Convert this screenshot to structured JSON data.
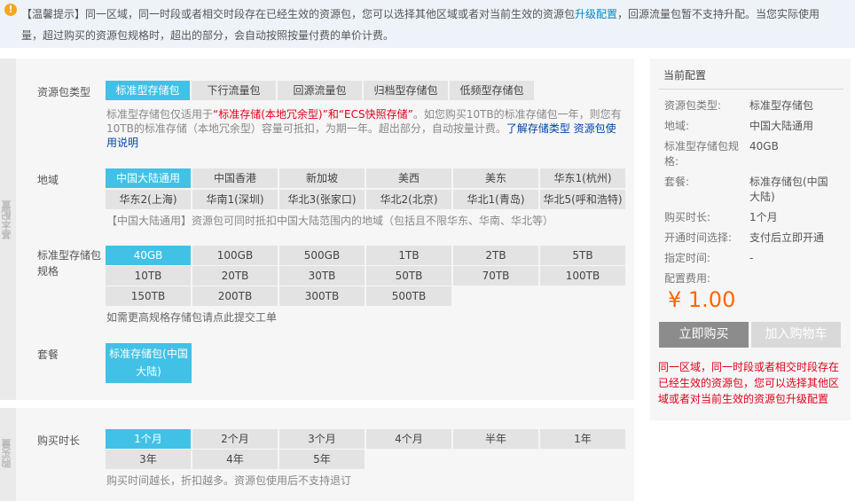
{
  "notice": {
    "icon": "info-icon",
    "line1_prefix": "【温馨提示】同一区域，同一时段或者相交时段存在已经生效的资源包，您可以选择其他区域或者对当前生效的资源包",
    "line1_link": "升级配置",
    "line1_suffix": "，回源流量包暂不支持升配。当您实际使用",
    "line2": "量，超过购买的资源包规格时，超出的部分，会自动按照按量付费的单价计费。"
  },
  "basic": {
    "side_label": "基本配置",
    "type_label": "资源包类型",
    "types": [
      "标准型存储包",
      "下行流量包",
      "回源流量包",
      "归档型存储包",
      "低频型存储包"
    ],
    "type_desc_prefix": "标准型存储包仅适用于",
    "type_desc_red": "“标准存储(本地冗余型)”和“ECS快照存储”",
    "type_desc_mid": "。如您购买10TB的标准存储包一年，则您有10TB的标准存储（本地冗余型）容量可抵扣，为期一年。超出部分，自动按量计费。",
    "type_desc_link": "了解存储类型 资源包使用说明",
    "region_label": "地域",
    "regions_row1": [
      "中国大陆通用",
      "中国香港",
      "新加坡",
      "美西",
      "美东",
      "华东1(杭州)"
    ],
    "regions_row2": [
      "华东2(上海)",
      "华南1(深圳)",
      "华北3(张家口)",
      "华北2(北京)",
      "华北1(青岛)",
      "华北5(呼和浩特)"
    ],
    "region_desc": "【中国大陆通用】资源包可同时抵扣中国大陆范围内的地域（包括且不限华东、华南、华北等）",
    "spec_label_1": "标准型存储包",
    "spec_label_2": "规格",
    "specs_row1": [
      "40GB",
      "100GB",
      "500GB",
      "1TB",
      "2TB",
      "5TB"
    ],
    "specs_row2": [
      "10TB",
      "20TB",
      "30TB",
      "50TB",
      "70TB",
      "100TB"
    ],
    "specs_row3": [
      "150TB",
      "200TB",
      "300TB",
      "500TB"
    ],
    "spec_desc": "如需更高规格存储包请点此提交工单",
    "package_label": "套餐",
    "package_option_1": "标准存储包(中国",
    "package_option_2": "大陆)"
  },
  "buy": {
    "side_label": "购买量",
    "duration_label": "购买时长",
    "durations_row1": [
      "1个月",
      "2个月",
      "3个月",
      "4个月",
      "半年",
      "1年"
    ],
    "durations_row2": [
      "3年",
      "4年",
      "5年"
    ],
    "duration_desc": "购买时间越长，折扣越多。资源包使用后不支持退订"
  },
  "panel": {
    "title": "当前配置",
    "rows": [
      {
        "k1": "资源包类型:",
        "k2": "",
        "v1": "标准型存储包",
        "v2": ""
      },
      {
        "k1": "地域:",
        "k2": "",
        "v1": "中国大陆通用",
        "v2": ""
      },
      {
        "k1": "标准型存储包规",
        "k2": "格:",
        "v1": "40GB",
        "v2": ""
      },
      {
        "k1": "套餐:",
        "k2": "",
        "v1": "标准存储包(中国",
        "v2": "大陆)"
      },
      {
        "k1": "购买时长:",
        "k2": "",
        "v1": "1个月",
        "v2": ""
      },
      {
        "k1": "开通时间选择:",
        "k2": "",
        "v1": "支付后立即开通",
        "v2": ""
      },
      {
        "k1": "指定时间:",
        "k2": "",
        "v1": "-",
        "v2": ""
      },
      {
        "k1": "配置费用:",
        "k2": "",
        "v1": "",
        "v2": ""
      }
    ],
    "price": "¥ 1.00",
    "buy_button": "立即购买",
    "cart_button": "加入购物车",
    "warning": "同一区域，同一时段或者相交时段存在已经生效的资源包，您可以选择其他区域或者对当前生效的资源包升级配置"
  },
  "colors": {
    "selected": "#41c1e6",
    "option": "#e3e3e3",
    "price": "#ff6600",
    "warning": "#e0001a",
    "link": "#0088cc"
  }
}
